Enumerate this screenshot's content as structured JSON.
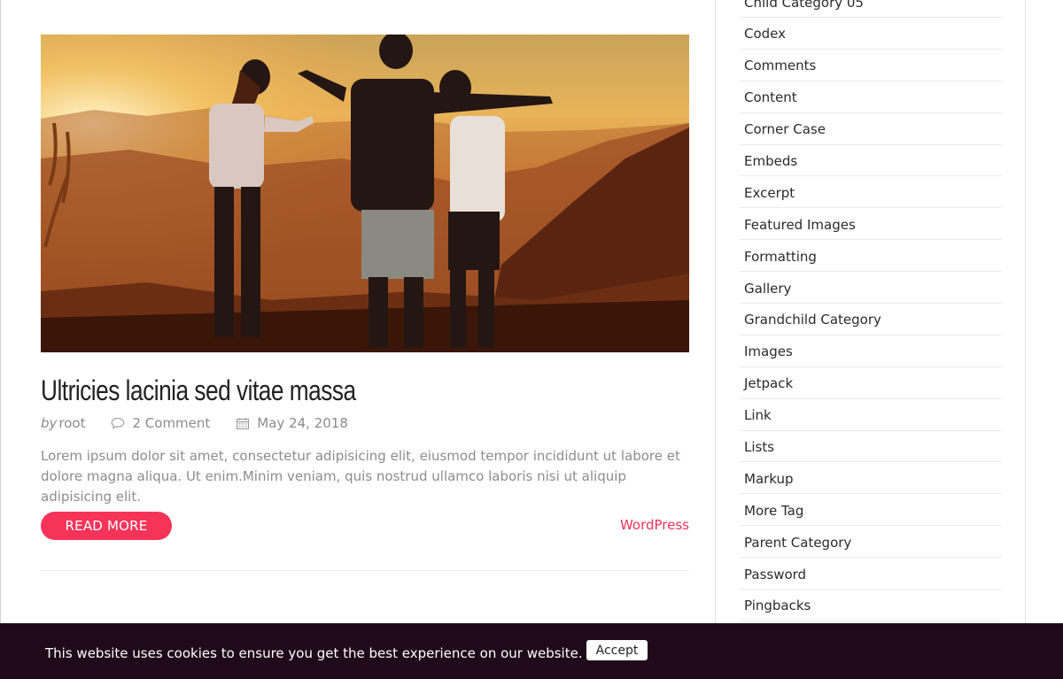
{
  "post": {
    "title": "Ultricies lacinia sed vitae massa",
    "meta": {
      "by_label": "by",
      "author": "root",
      "comments": "2 Comment",
      "date": "May 24, 2018"
    },
    "excerpt": "Lorem ipsum dolor sit amet, consectetur adipisicing elit, eiusmod tempor incididunt ut labore et dolore magna aliqua. Ut enim.Minim veniam, quis nostrud ullamco laboris nisi ut aliquip adipisicing elit.",
    "read_more_label": "READ MORE",
    "category": "WordPress"
  },
  "sidebar": {
    "categories": [
      "Child Category 05",
      "Codex",
      "Comments",
      "Content",
      "Corner Case",
      "Embeds",
      "Excerpt",
      "Featured Images",
      "Formatting",
      "Gallery",
      "Grandchild Category",
      "Images",
      "Jetpack",
      "Link",
      "Lists",
      "Markup",
      "More Tag",
      "Parent Category",
      "Password",
      "Pingbacks"
    ]
  },
  "cookie": {
    "message": "This website uses cookies to ensure you get the best experience on our website.",
    "accept_label": "Accept"
  },
  "colors": {
    "accent": "#f6345a",
    "cookie_bar": "#1f0a1b"
  }
}
